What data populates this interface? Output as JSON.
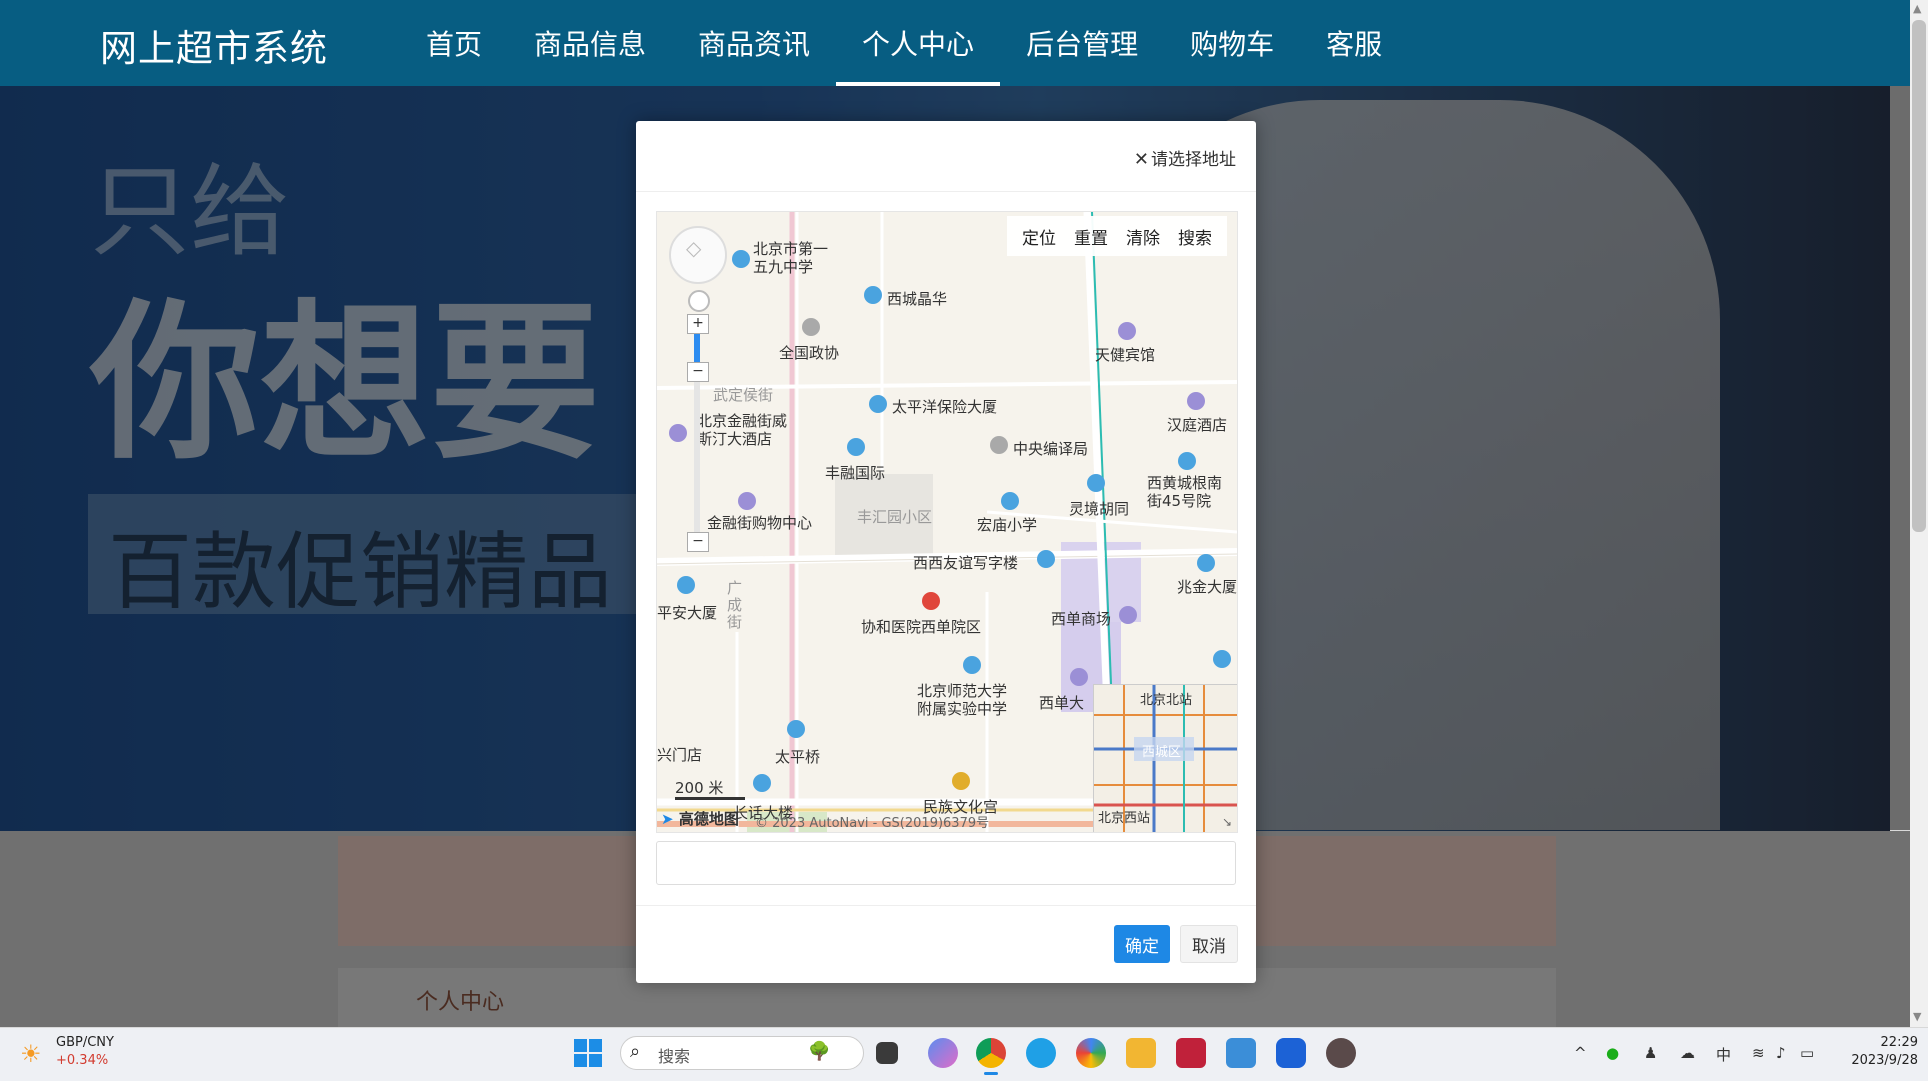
{
  "header": {
    "logo": "网上超市系统",
    "nav": [
      {
        "label": "首页"
      },
      {
        "label": "商品信息"
      },
      {
        "label": "商品资讯"
      },
      {
        "label": "个人中心",
        "active": true
      },
      {
        "label": "后台管理"
      },
      {
        "label": "购物车"
      },
      {
        "label": "客服"
      }
    ]
  },
  "banner": {
    "line1": "只给",
    "line2": "你想要",
    "promo": "百款促销精品"
  },
  "page": {
    "section_title": "个人中心"
  },
  "dialog": {
    "title": "请选择地址",
    "close_glyph": "✕",
    "map": {
      "toolbar": [
        "定位",
        "重置",
        "清除",
        "搜索"
      ],
      "scale": "200 米",
      "brand": "高德地图",
      "copyright": "© 2023 AutoNavi - GS(2019)6379号",
      "labels": [
        "北京市第一五九中学",
        "西城晶华",
        "全国政协",
        "天健宾馆",
        "武定侯街",
        "太平洋保险大厦",
        "汉庭酒店",
        "北京金融街威斯汀大酒店",
        "丰融国际",
        "中央编译局",
        "西黄城根南街45号院",
        "金融街购物中心",
        "丰汇园小区",
        "宏庙小学",
        "灵境胡同",
        "西西友谊写字楼",
        "兆金大厦",
        "平安大厦",
        "广成街",
        "协和医院西单院区",
        "西单商场",
        "北京师范大学附属实验中学",
        "西单大",
        "兴门店",
        "太平桥",
        "民族文化宫",
        "长话大楼",
        "北京北站",
        "西城区",
        "北京西站"
      ]
    },
    "address_value": "",
    "confirm": "确定",
    "cancel": "取消"
  },
  "taskbar": {
    "ticker_name": "GBP/CNY",
    "ticker_change": "+0.34%",
    "search_placeholder": "搜索",
    "time": "22:29",
    "date": "2023/9/28"
  }
}
